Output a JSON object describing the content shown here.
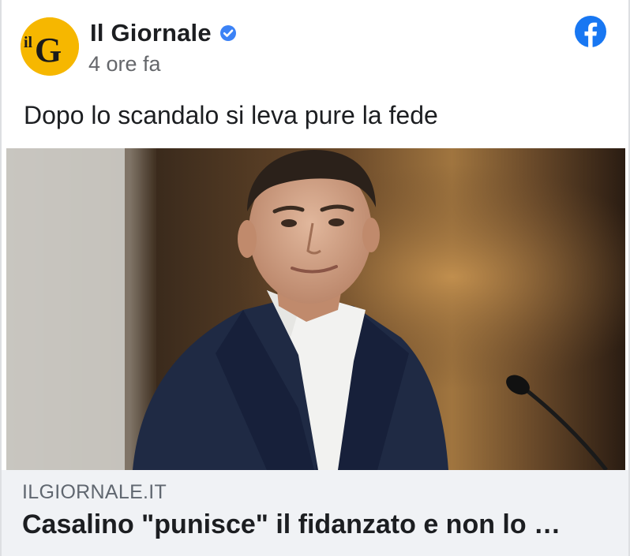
{
  "post": {
    "page_name": "Il Giornale",
    "avatar_logo_text": "ilG",
    "verified_icon": "verified-badge-icon",
    "timestamp": "4 ore fa",
    "platform_icon": "facebook-icon",
    "text": "Dopo lo scandalo si leva pure la fede"
  },
  "link_preview": {
    "image_alt": "man in dark suit and white shirt standing near a microphone",
    "domain": "ILGIORNALE.IT",
    "headline": "Casalino \"punisce\" il fidanzato e non lo …"
  },
  "colors": {
    "facebook_blue": "#1877f2",
    "verified_blue": "#3b82f6",
    "logo_yellow": "#f6b700",
    "footer_bg": "#f0f2f5"
  }
}
